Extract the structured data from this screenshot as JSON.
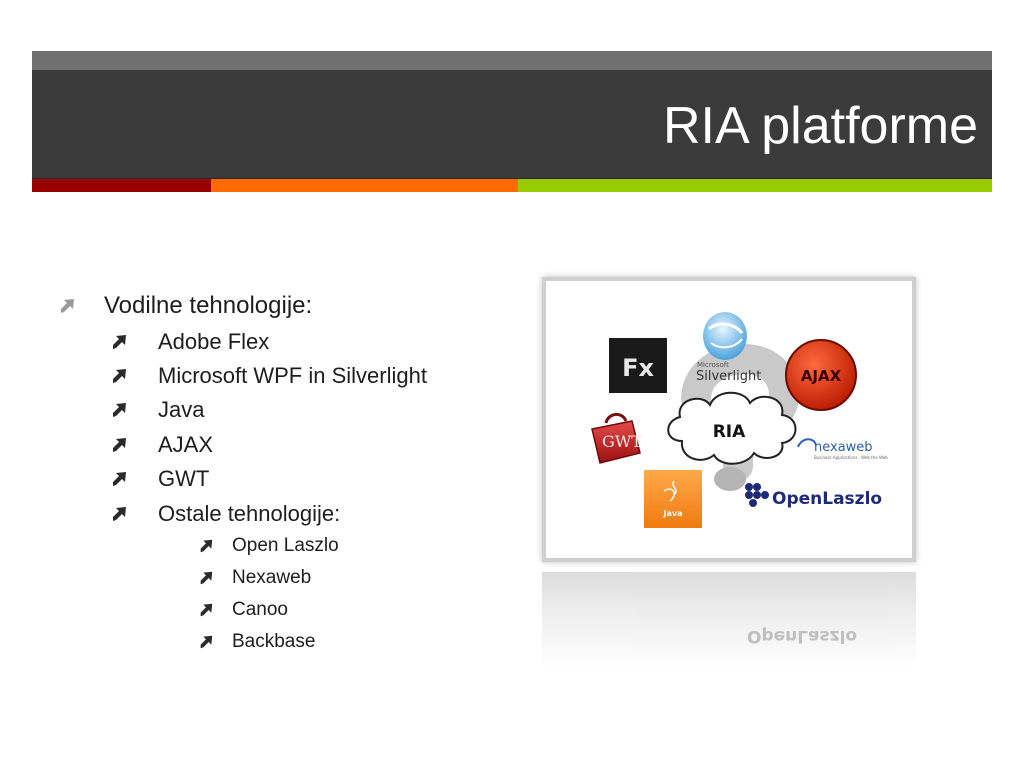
{
  "slide": {
    "title": "RIA platforme"
  },
  "colors": {
    "title_band": "#3b3b3b",
    "title_top": "#707070",
    "accent_red": "#990000",
    "accent_orange": "#ff6a00",
    "accent_green": "#99cc00"
  },
  "bullets": {
    "main": "Vodilne tehnologije:",
    "leading": [
      "Adobe Flex",
      "Microsoft WPF in Silverlight",
      "Java",
      "AJAX",
      "GWT",
      "Ostale tehnologije:"
    ],
    "other": [
      "Open Laszlo",
      "Nexaweb",
      "Canoo",
      "Backbase"
    ]
  },
  "image": {
    "center_label": "RIA",
    "logos": {
      "flex": "Fx",
      "silverlight_small": "Microsoft",
      "silverlight": "Silverlight",
      "ajax": "AJAX",
      "gwt": "GWT",
      "nexaweb": "nexaweb",
      "nexaweb_tagline": "Business Applications · Web the Web",
      "java": "Java",
      "openlaszlo": "OpenLaszlo"
    }
  }
}
